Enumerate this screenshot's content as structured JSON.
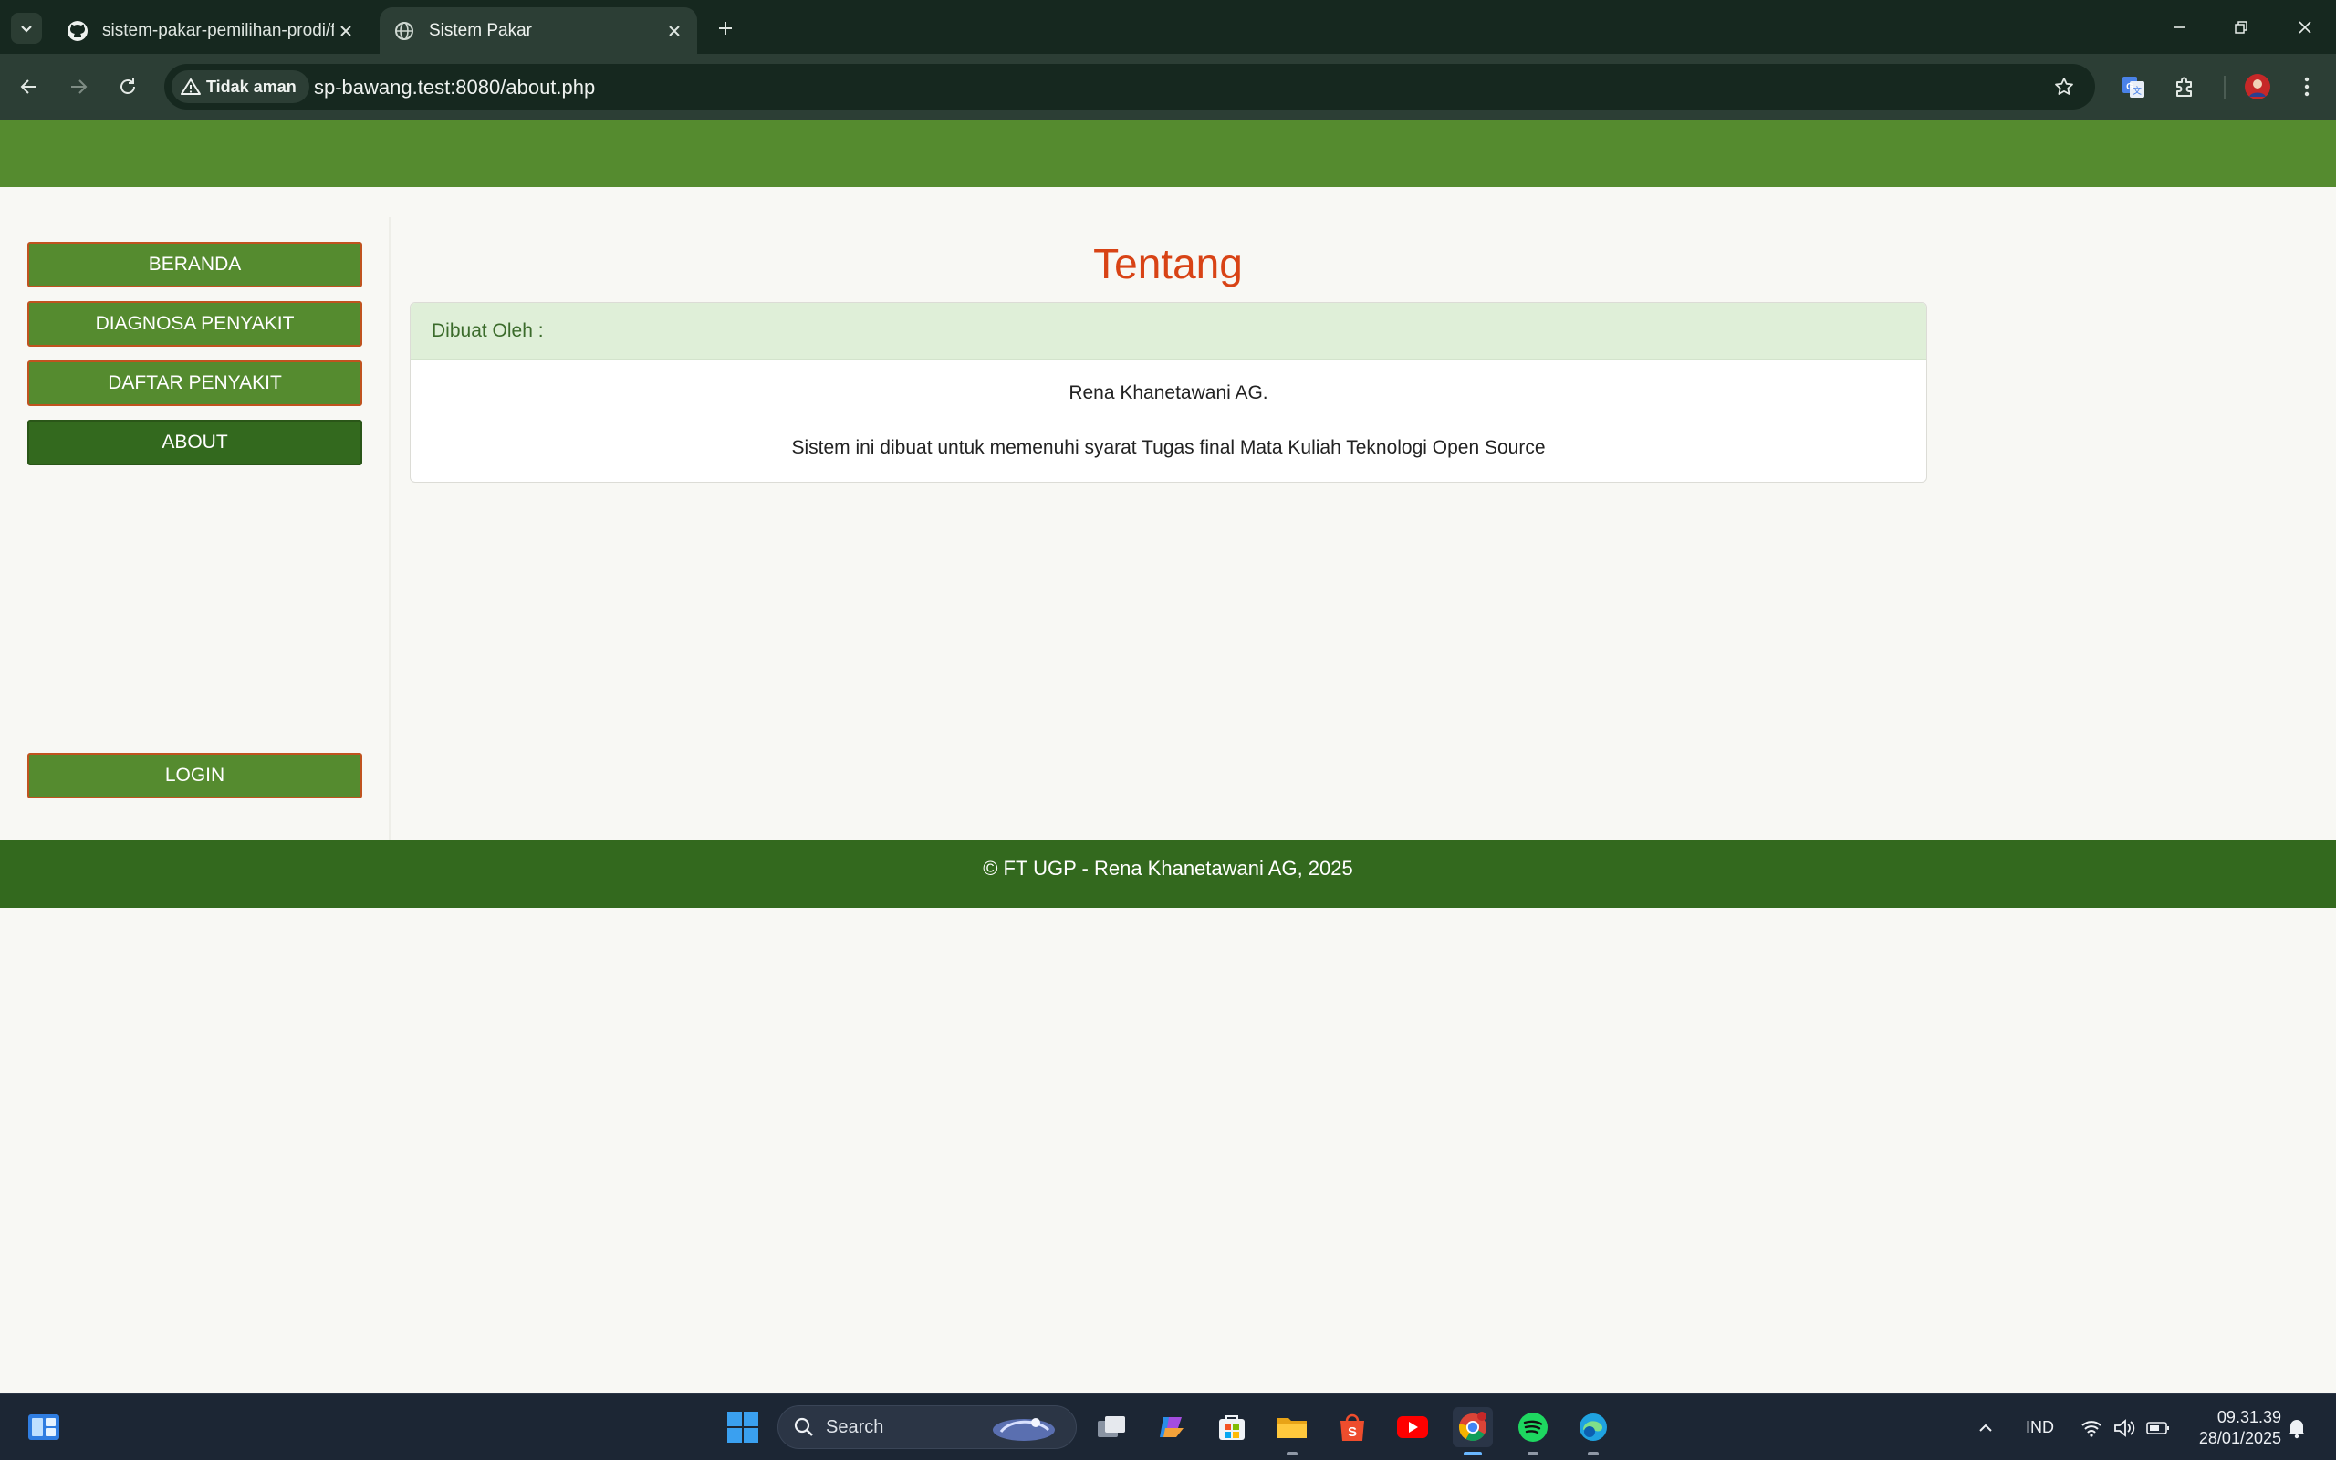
{
  "browser": {
    "tabs": [
      {
        "title": "sistem-pakar-pemilihan-prodi/f",
        "icon": "github-icon",
        "active": false
      },
      {
        "title": "Sistem Pakar",
        "icon": "globe-icon",
        "active": true
      }
    ],
    "security_label": "Tidak aman",
    "url": "sp-bawang.test:8080/about.php"
  },
  "sidebar": {
    "items": [
      {
        "label": "BERANDA"
      },
      {
        "label": "DIAGNOSA PENYAKIT"
      },
      {
        "label": "DAFTAR PENYAKIT"
      },
      {
        "label": "ABOUT",
        "active": true
      }
    ],
    "login_label": "LOGIN"
  },
  "main": {
    "title": "Tentang",
    "card": {
      "header": "Dibuat Oleh :",
      "author": "Rena Khanetawani AG.",
      "description": "Sistem ini dibuat untuk memenuhi syarat Tugas final Mata Kuliah Teknologi Open Source"
    }
  },
  "footer": {
    "text": "© FT UGP - Rena Khanetawani AG, 2025"
  },
  "taskbar": {
    "search_placeholder": "Search",
    "language": "IND",
    "time": "09.31.39",
    "date": "28/01/2025"
  },
  "colors": {
    "header_green": "#558b2f",
    "footer_green": "#33691e",
    "title_orange": "#d84315",
    "button_border": "#c0531f",
    "card_header_bg": "#dfefd8"
  }
}
